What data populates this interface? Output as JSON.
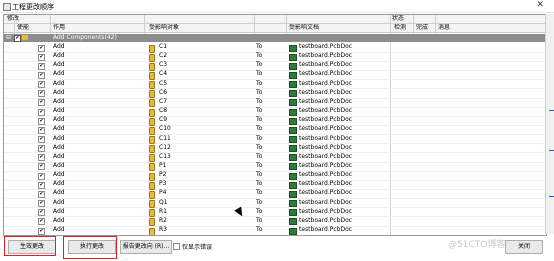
{
  "window": {
    "title": "工程更改顺序",
    "close": "✕"
  },
  "header": {
    "modify": "修改",
    "status": "状态",
    "enable": "使能",
    "action": "作用",
    "affected_object": "受影响对象",
    "affected_doc": "受影响文档",
    "check": "检测",
    "done": "完成",
    "message": "消息"
  },
  "group": {
    "label": "Add Components(42)",
    "expand": "⊟"
  },
  "rows": [
    {
      "action": "Add",
      "object": "C1",
      "to": "To",
      "doc": "testboard.PcbDoc"
    },
    {
      "action": "Add",
      "object": "C2",
      "to": "To",
      "doc": "testboard.PcbDoc"
    },
    {
      "action": "Add",
      "object": "C3",
      "to": "To",
      "doc": "testboard.PcbDoc"
    },
    {
      "action": "Add",
      "object": "C4",
      "to": "To",
      "doc": "testboard.PcbDoc"
    },
    {
      "action": "Add",
      "object": "C5",
      "to": "To",
      "doc": "testboard.PcbDoc"
    },
    {
      "action": "Add",
      "object": "C6",
      "to": "To",
      "doc": "testboard.PcbDoc"
    },
    {
      "action": "Add",
      "object": "C7",
      "to": "To",
      "doc": "testboard.PcbDoc"
    },
    {
      "action": "Add",
      "object": "C8",
      "to": "To",
      "doc": "testboard.PcbDoc"
    },
    {
      "action": "Add",
      "object": "C9",
      "to": "To",
      "doc": "testboard.PcbDoc"
    },
    {
      "action": "Add",
      "object": "C10",
      "to": "To",
      "doc": "testboard.PcbDoc"
    },
    {
      "action": "Add",
      "object": "C11",
      "to": "To",
      "doc": "testboard.PcbDoc"
    },
    {
      "action": "Add",
      "object": "C12",
      "to": "To",
      "doc": "testboard.PcbDoc"
    },
    {
      "action": "Add",
      "object": "C13",
      "to": "To",
      "doc": "testboard.PcbDoc"
    },
    {
      "action": "Add",
      "object": "P1",
      "to": "To",
      "doc": "testboard.PcbDoc"
    },
    {
      "action": "Add",
      "object": "P2",
      "to": "To",
      "doc": "testboard.PcbDoc"
    },
    {
      "action": "Add",
      "object": "P3",
      "to": "To",
      "doc": "testboard.PcbDoc"
    },
    {
      "action": "Add",
      "object": "P4",
      "to": "To",
      "doc": "testboard.PcbDoc"
    },
    {
      "action": "Add",
      "object": "Q1",
      "to": "To",
      "doc": "testboard.PcbDoc"
    },
    {
      "action": "Add",
      "object": "R1",
      "to": "To",
      "doc": "testboard.PcbDoc"
    },
    {
      "action": "Add",
      "object": "R2",
      "to": "To",
      "doc": "testboard.PcbDoc"
    },
    {
      "action": "Add",
      "object": "R3",
      "to": "To",
      "doc": "testboard.PcbDoc"
    }
  ],
  "buttons": {
    "validate": "生效更改",
    "execute": "执行更改",
    "report": "报告更改向 (R)...",
    "only_errors": "仅显示错误",
    "close": "关闭"
  },
  "watermark": "@51CTO博客",
  "colors": {
    "highlight": "#e02020",
    "group_bg": "#8c8c8c",
    "doc_icon": "#2f7b3a",
    "comp_icon": "#e8b83a"
  }
}
